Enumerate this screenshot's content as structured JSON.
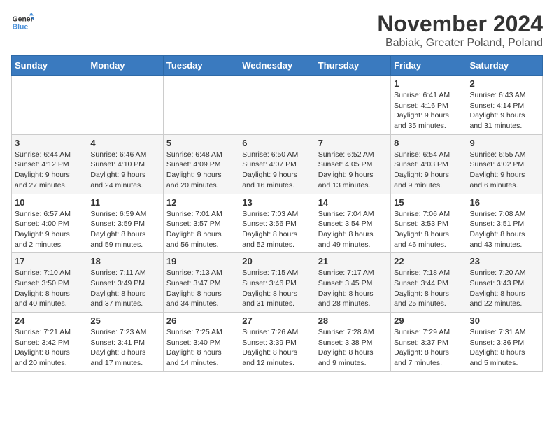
{
  "logo": {
    "general": "General",
    "blue": "Blue"
  },
  "title": "November 2024",
  "subtitle": "Babiak, Greater Poland, Poland",
  "headers": [
    "Sunday",
    "Monday",
    "Tuesday",
    "Wednesday",
    "Thursday",
    "Friday",
    "Saturday"
  ],
  "weeks": [
    [
      {
        "day": "",
        "info": ""
      },
      {
        "day": "",
        "info": ""
      },
      {
        "day": "",
        "info": ""
      },
      {
        "day": "",
        "info": ""
      },
      {
        "day": "",
        "info": ""
      },
      {
        "day": "1",
        "info": "Sunrise: 6:41 AM\nSunset: 4:16 PM\nDaylight: 9 hours\nand 35 minutes."
      },
      {
        "day": "2",
        "info": "Sunrise: 6:43 AM\nSunset: 4:14 PM\nDaylight: 9 hours\nand 31 minutes."
      }
    ],
    [
      {
        "day": "3",
        "info": "Sunrise: 6:44 AM\nSunset: 4:12 PM\nDaylight: 9 hours\nand 27 minutes."
      },
      {
        "day": "4",
        "info": "Sunrise: 6:46 AM\nSunset: 4:10 PM\nDaylight: 9 hours\nand 24 minutes."
      },
      {
        "day": "5",
        "info": "Sunrise: 6:48 AM\nSunset: 4:09 PM\nDaylight: 9 hours\nand 20 minutes."
      },
      {
        "day": "6",
        "info": "Sunrise: 6:50 AM\nSunset: 4:07 PM\nDaylight: 9 hours\nand 16 minutes."
      },
      {
        "day": "7",
        "info": "Sunrise: 6:52 AM\nSunset: 4:05 PM\nDaylight: 9 hours\nand 13 minutes."
      },
      {
        "day": "8",
        "info": "Sunrise: 6:54 AM\nSunset: 4:03 PM\nDaylight: 9 hours\nand 9 minutes."
      },
      {
        "day": "9",
        "info": "Sunrise: 6:55 AM\nSunset: 4:02 PM\nDaylight: 9 hours\nand 6 minutes."
      }
    ],
    [
      {
        "day": "10",
        "info": "Sunrise: 6:57 AM\nSunset: 4:00 PM\nDaylight: 9 hours\nand 2 minutes."
      },
      {
        "day": "11",
        "info": "Sunrise: 6:59 AM\nSunset: 3:59 PM\nDaylight: 8 hours\nand 59 minutes."
      },
      {
        "day": "12",
        "info": "Sunrise: 7:01 AM\nSunset: 3:57 PM\nDaylight: 8 hours\nand 56 minutes."
      },
      {
        "day": "13",
        "info": "Sunrise: 7:03 AM\nSunset: 3:56 PM\nDaylight: 8 hours\nand 52 minutes."
      },
      {
        "day": "14",
        "info": "Sunrise: 7:04 AM\nSunset: 3:54 PM\nDaylight: 8 hours\nand 49 minutes."
      },
      {
        "day": "15",
        "info": "Sunrise: 7:06 AM\nSunset: 3:53 PM\nDaylight: 8 hours\nand 46 minutes."
      },
      {
        "day": "16",
        "info": "Sunrise: 7:08 AM\nSunset: 3:51 PM\nDaylight: 8 hours\nand 43 minutes."
      }
    ],
    [
      {
        "day": "17",
        "info": "Sunrise: 7:10 AM\nSunset: 3:50 PM\nDaylight: 8 hours\nand 40 minutes."
      },
      {
        "day": "18",
        "info": "Sunrise: 7:11 AM\nSunset: 3:49 PM\nDaylight: 8 hours\nand 37 minutes."
      },
      {
        "day": "19",
        "info": "Sunrise: 7:13 AM\nSunset: 3:47 PM\nDaylight: 8 hours\nand 34 minutes."
      },
      {
        "day": "20",
        "info": "Sunrise: 7:15 AM\nSunset: 3:46 PM\nDaylight: 8 hours\nand 31 minutes."
      },
      {
        "day": "21",
        "info": "Sunrise: 7:17 AM\nSunset: 3:45 PM\nDaylight: 8 hours\nand 28 minutes."
      },
      {
        "day": "22",
        "info": "Sunrise: 7:18 AM\nSunset: 3:44 PM\nDaylight: 8 hours\nand 25 minutes."
      },
      {
        "day": "23",
        "info": "Sunrise: 7:20 AM\nSunset: 3:43 PM\nDaylight: 8 hours\nand 22 minutes."
      }
    ],
    [
      {
        "day": "24",
        "info": "Sunrise: 7:21 AM\nSunset: 3:42 PM\nDaylight: 8 hours\nand 20 minutes."
      },
      {
        "day": "25",
        "info": "Sunrise: 7:23 AM\nSunset: 3:41 PM\nDaylight: 8 hours\nand 17 minutes."
      },
      {
        "day": "26",
        "info": "Sunrise: 7:25 AM\nSunset: 3:40 PM\nDaylight: 8 hours\nand 14 minutes."
      },
      {
        "day": "27",
        "info": "Sunrise: 7:26 AM\nSunset: 3:39 PM\nDaylight: 8 hours\nand 12 minutes."
      },
      {
        "day": "28",
        "info": "Sunrise: 7:28 AM\nSunset: 3:38 PM\nDaylight: 8 hours\nand 9 minutes."
      },
      {
        "day": "29",
        "info": "Sunrise: 7:29 AM\nSunset: 3:37 PM\nDaylight: 8 hours\nand 7 minutes."
      },
      {
        "day": "30",
        "info": "Sunrise: 7:31 AM\nSunset: 3:36 PM\nDaylight: 8 hours\nand 5 minutes."
      }
    ]
  ]
}
